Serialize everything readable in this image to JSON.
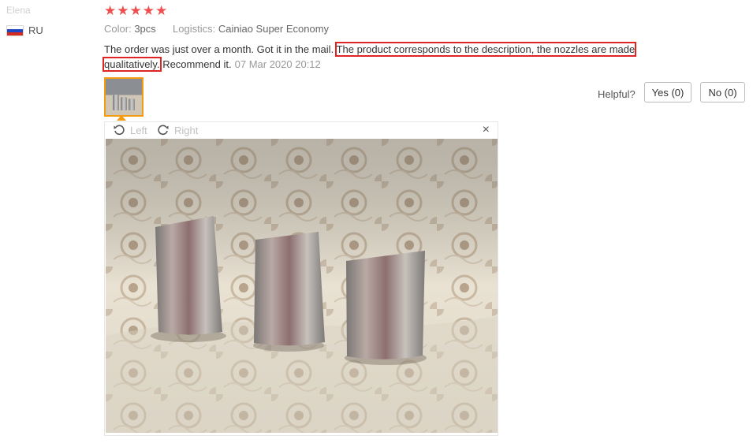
{
  "reviewer": {
    "name": "Elena",
    "country": "RU",
    "flag_icon": "russia-flag-icon"
  },
  "rating": {
    "stars": 5,
    "star_color": "#f04f4f"
  },
  "order": {
    "color_label": "Color:",
    "color_value": "3pcs",
    "logistics_label": "Logistics:",
    "logistics_value": "Cainiao Super Economy"
  },
  "review": {
    "text_plain": "The order was just over a month. Got it in the mail. ",
    "text_highlighted": "The product corresponds to the description, the nozzles are made qualitatively.",
    "text_after": " Recommend it.",
    "date": "07 Mar 2020 20:12",
    "highlight_color": "#e02424"
  },
  "helpful": {
    "label": "Helpful?",
    "yes_label": "Yes (0)",
    "no_label": "No (0)"
  },
  "viewer": {
    "rotate_left_label": "Left",
    "rotate_right_label": "Right",
    "close_icon": "×",
    "thumbnail_border_color": "#f39c12"
  }
}
